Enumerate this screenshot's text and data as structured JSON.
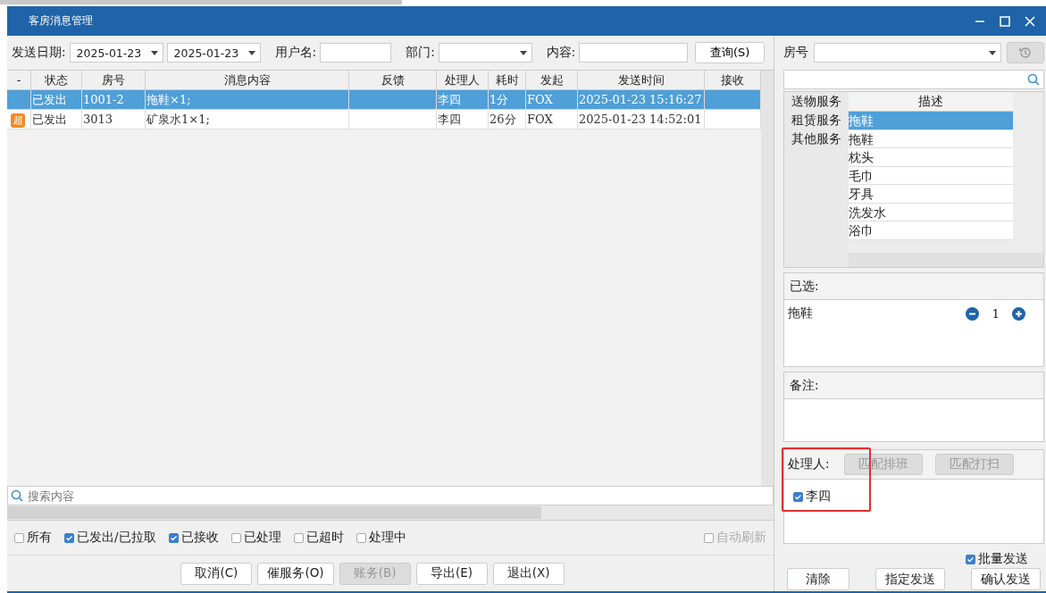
{
  "window": {
    "title": "客房消息管理"
  },
  "toolbar": {
    "date_label": "发送日期:",
    "date_from": "2025-01-23",
    "date_to": "2025-01-23",
    "user_label": "用户名:",
    "dept_label": "部门:",
    "content_label": "内容:",
    "query_button": "查询(S)"
  },
  "table": {
    "columns": [
      "-",
      "状态",
      "房号",
      "消息内容",
      "反馈",
      "处理人",
      "耗时",
      "发起",
      "发送时间",
      "接收"
    ],
    "rows": [
      {
        "selected": true,
        "cells": [
          "",
          "已发出",
          "1001-2",
          "拖鞋×1;",
          "",
          "李四",
          "1分",
          "FOX",
          "2025-01-23 15:16:27",
          ""
        ]
      },
      {
        "selected": false,
        "cells": [
          "超",
          "已发出",
          "3013",
          "矿泉水1×1;",
          "",
          "李四",
          "26分",
          "FOX",
          "2025-01-23 14:52:01",
          ""
        ]
      }
    ]
  },
  "search": {
    "placeholder": "搜索内容"
  },
  "filters": [
    {
      "label": "所有",
      "checked": false
    },
    {
      "label": "已发出/已拉取",
      "checked": true
    },
    {
      "label": "已接收",
      "checked": true
    },
    {
      "label": "已处理",
      "checked": false
    },
    {
      "label": "已超时",
      "checked": false
    },
    {
      "label": "处理中",
      "checked": false
    }
  ],
  "auto_refresh": {
    "label": "自动刷新",
    "checked": false,
    "disabled": true
  },
  "buttons": [
    {
      "label": "取消(C)",
      "disabled": false
    },
    {
      "label": "催服务(O)",
      "disabled": false
    },
    {
      "label": "账务(B)",
      "disabled": true
    },
    {
      "label": "导出(E)",
      "disabled": false
    },
    {
      "label": "退出(X)",
      "disabled": false
    }
  ],
  "side": {
    "room_label": "房号",
    "categories": [
      "送物服务",
      "租赁服务",
      "其他服务"
    ],
    "items_header": "描述",
    "items": [
      {
        "label": "拖鞋",
        "selected": true
      },
      {
        "label": "拖鞋",
        "selected": false
      },
      {
        "label": "枕头",
        "selected": false
      },
      {
        "label": "毛巾",
        "selected": false
      },
      {
        "label": "牙具",
        "selected": false
      },
      {
        "label": "洗发水",
        "selected": false
      },
      {
        "label": "浴巾",
        "selected": false
      }
    ],
    "chosen_label": "已选:",
    "chosen": [
      {
        "name": "拖鞋",
        "count": "1"
      }
    ],
    "remark_label": "备注:",
    "handler_label": "处理人:",
    "handler_buttons": [
      "匹配排班",
      "匹配打扫"
    ],
    "handlers": [
      {
        "name": "李四",
        "checked": true
      }
    ],
    "batch": {
      "label": "批量发送",
      "checked": true
    },
    "actions": [
      "清除",
      "指定发送",
      "确认发送"
    ]
  }
}
